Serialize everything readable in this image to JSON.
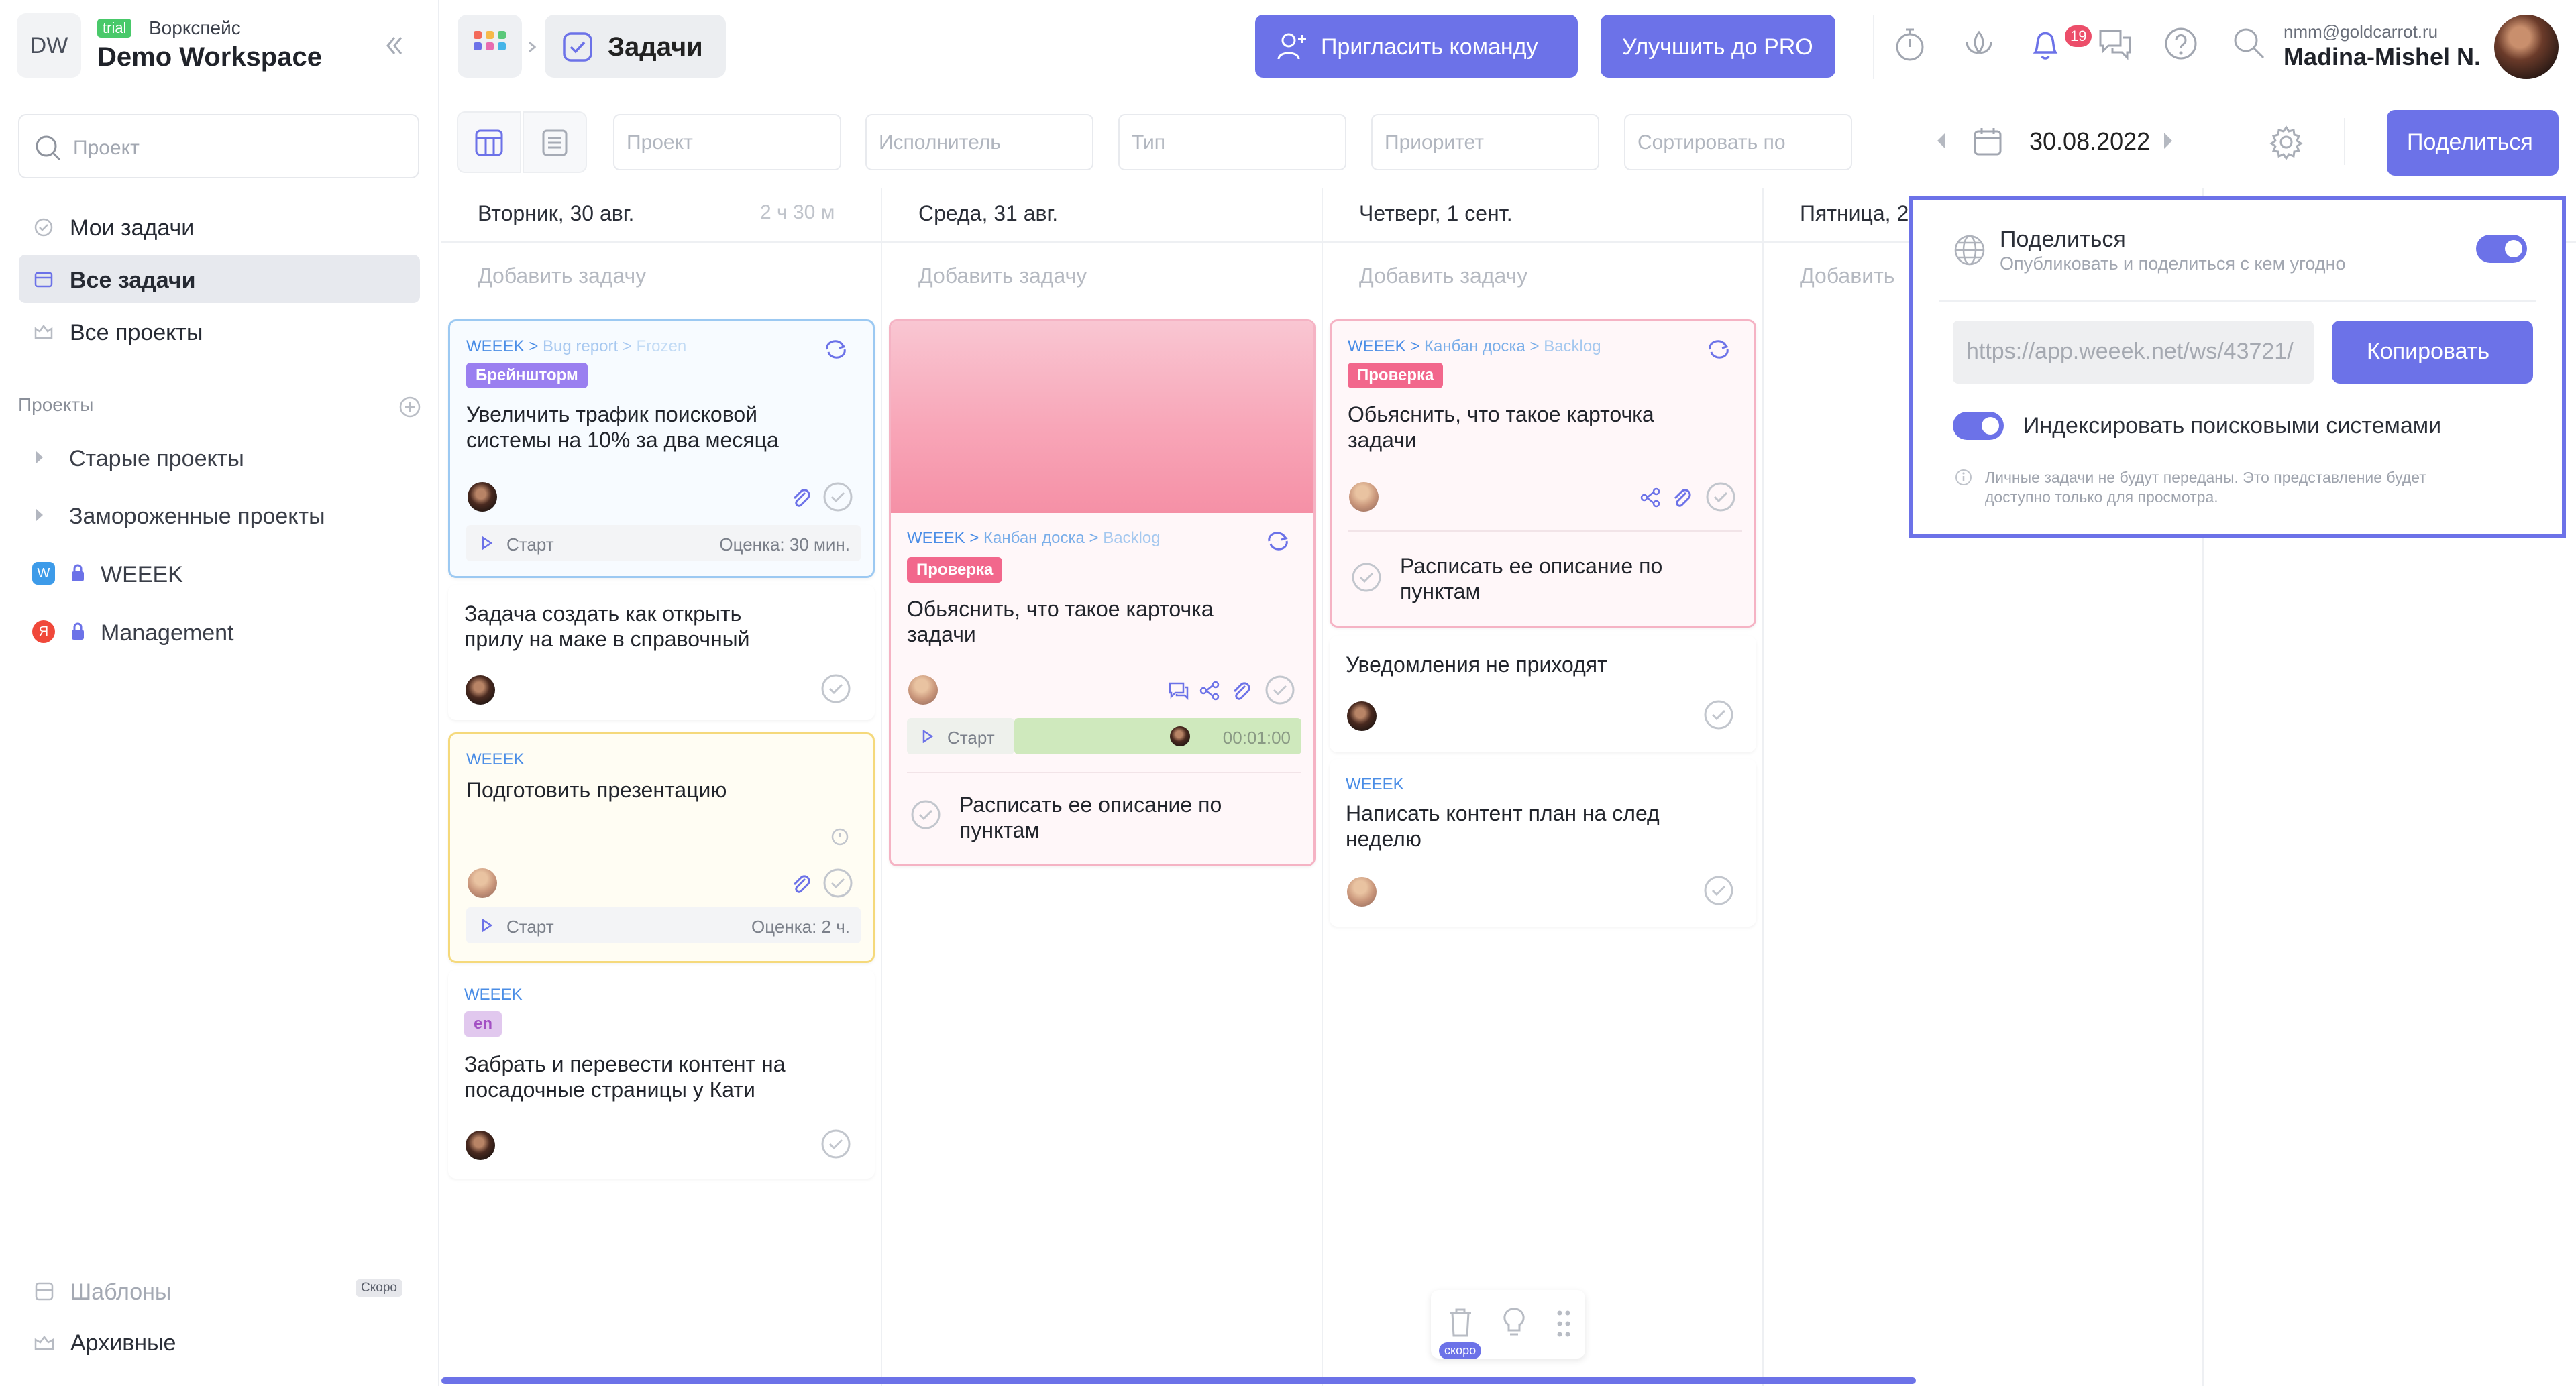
{
  "workspace": {
    "initials": "DW",
    "trial": "trial",
    "label": "Воркспейс",
    "name": "Demo Workspace"
  },
  "sidebar": {
    "search_placeholder": "Проект",
    "nav": [
      {
        "label": "Мои задачи"
      },
      {
        "label": "Все задачи"
      },
      {
        "label": "Все проекты"
      }
    ],
    "projects_title": "Проекты",
    "projects": [
      {
        "label": "Старые проекты"
      },
      {
        "label": "Замороженные проекты"
      },
      {
        "label": "WEEEK",
        "letter": "W"
      },
      {
        "label": "Management",
        "letter": "Я"
      }
    ],
    "templates": "Шаблоны",
    "soon": "Скоро",
    "archive": "Архивные"
  },
  "header": {
    "title": "Задачи",
    "invite": "Пригласить команду",
    "upgrade": "Улучшить до PRO",
    "notif_count": "19",
    "email": "nmm@goldcarrot.ru",
    "user": "Madina-Mishel N."
  },
  "toolbar": {
    "filters": [
      "Проект",
      "Исполнитель",
      "Тип",
      "Приоритет",
      "Сортировать по"
    ],
    "date": "30.08.2022",
    "share": "Поделиться"
  },
  "columns": [
    {
      "title": "Вторник, 30 авг.",
      "time": "2 ч 30 м",
      "add": "Добавить задачу"
    },
    {
      "title": "Среда, 31 авг.",
      "add": "Добавить задачу"
    },
    {
      "title": "Четверг, 1 сент.",
      "add": "Добавить задачу"
    },
    {
      "title": "Пятница, 2",
      "add": "Добавить"
    }
  ],
  "cards": {
    "c1": {
      "path": [
        "WEEEK >",
        "Bug report >",
        "Frozen"
      ],
      "tag": "Брейншторм",
      "title": "Увеличить трафик поисковой системы на 10% за два месяца",
      "start": "Старт",
      "estimate": "Оценка: 30 мин."
    },
    "c2": {
      "title": "Задача создать как открыть прилу на маке в справочный"
    },
    "c3": {
      "path": [
        "WEEEK"
      ],
      "title": "Подготовить презентацию",
      "start": "Старт",
      "estimate": "Оценка: 2 ч."
    },
    "c4": {
      "path": [
        "WEEEK"
      ],
      "tag": "en",
      "title": "Забрать и перевести контент на посадочные страницы у Кати"
    },
    "c5": {
      "path": [
        "WEEEK >",
        "Канбан доска >",
        "Backlog"
      ],
      "tag": "Проверка",
      "title": "Обьяснить, что такое карточка задачи",
      "start": "Старт",
      "timer": "00:01:00",
      "subtask": "Расписать ее описание по пунктам"
    },
    "c6": {
      "path": [
        "WEEEK >",
        "Канбан доска >",
        "Backlog"
      ],
      "tag": "Проверка",
      "title": "Обьяснить, что такое карточка задачи",
      "subtask": "Расписать ее описание по пунктам"
    },
    "c7": {
      "title": "Уведомления не приходят"
    },
    "c8": {
      "path": [
        "WEEEK"
      ],
      "title": "Написать контент план на след неделю"
    }
  },
  "share_popup": {
    "title": "Поделиться",
    "subtitle": "Опубликовать и поделиться с кем угодно",
    "url": "https://app.weeek.net/ws/43721/",
    "copy": "Копировать",
    "index_label": "Индексировать поисковыми системами",
    "note": "Личные задачи не будут переданы. Это представление будет доступно только для просмотра."
  },
  "floating": {
    "soon": "скоро"
  },
  "colors": {
    "accent": "#6c72e8",
    "tag_brainstorm": "#8f7ae6",
    "tag_check": "#f2678c",
    "tag_en": "#b069c7"
  }
}
